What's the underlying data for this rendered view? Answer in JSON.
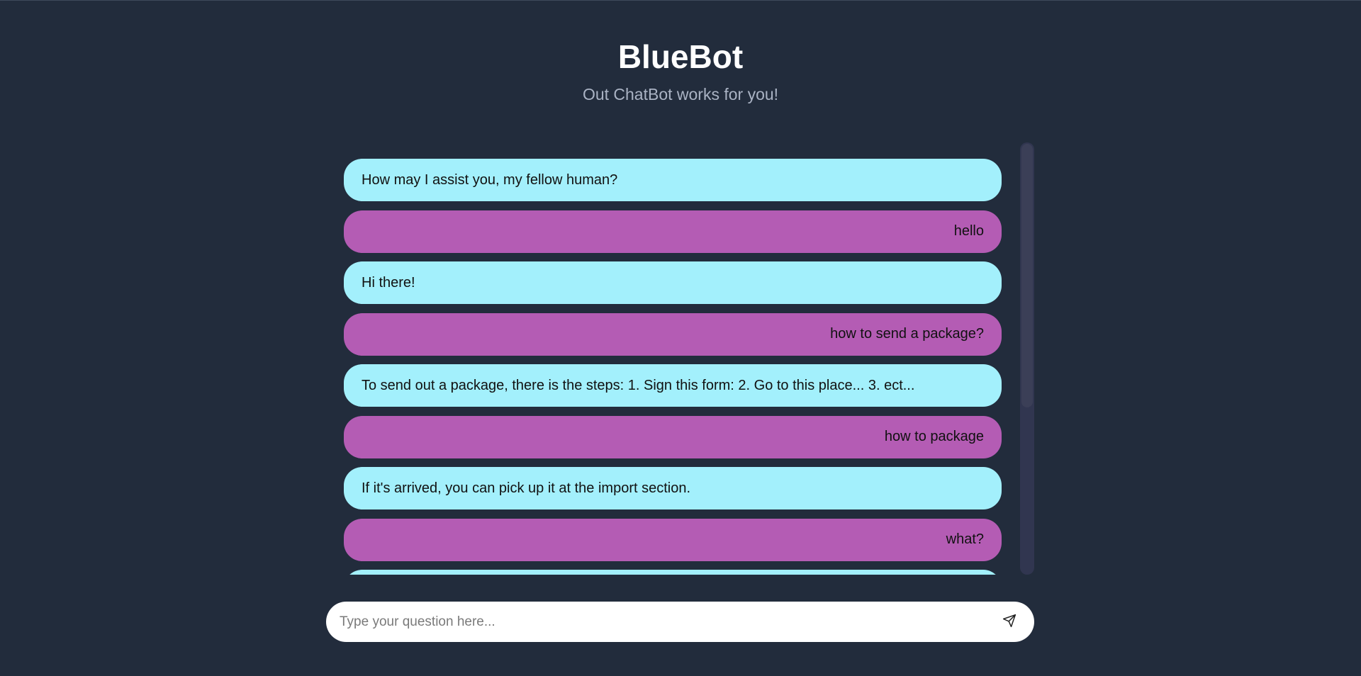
{
  "header": {
    "title": "BlueBot",
    "subtitle": "Out ChatBot works for you!"
  },
  "chat": {
    "messages": [
      {
        "sender": "bot",
        "text": "How may I assist you, my fellow human?"
      },
      {
        "sender": "user",
        "text": "hello"
      },
      {
        "sender": "bot",
        "text": "Hi there!"
      },
      {
        "sender": "user",
        "text": "how to send a package?"
      },
      {
        "sender": "bot",
        "text": "To send out a package, there is the steps: 1. Sign this form: 2. Go to this place... 3. ect..."
      },
      {
        "sender": "user",
        "text": "how to package"
      },
      {
        "sender": "bot",
        "text": "If it's arrived, you can pick up it at the import section."
      },
      {
        "sender": "user",
        "text": "what?"
      },
      {
        "sender": "bot",
        "text": ""
      }
    ]
  },
  "input": {
    "placeholder": "Type your question here...",
    "value": ""
  },
  "icons": {
    "send": "send-icon"
  },
  "colors": {
    "background": "#222c3c",
    "bot_bubble": "#a3f0fc",
    "user_bubble": "#b45cb4",
    "title": "#ffffff",
    "subtitle": "#aab3c4"
  }
}
